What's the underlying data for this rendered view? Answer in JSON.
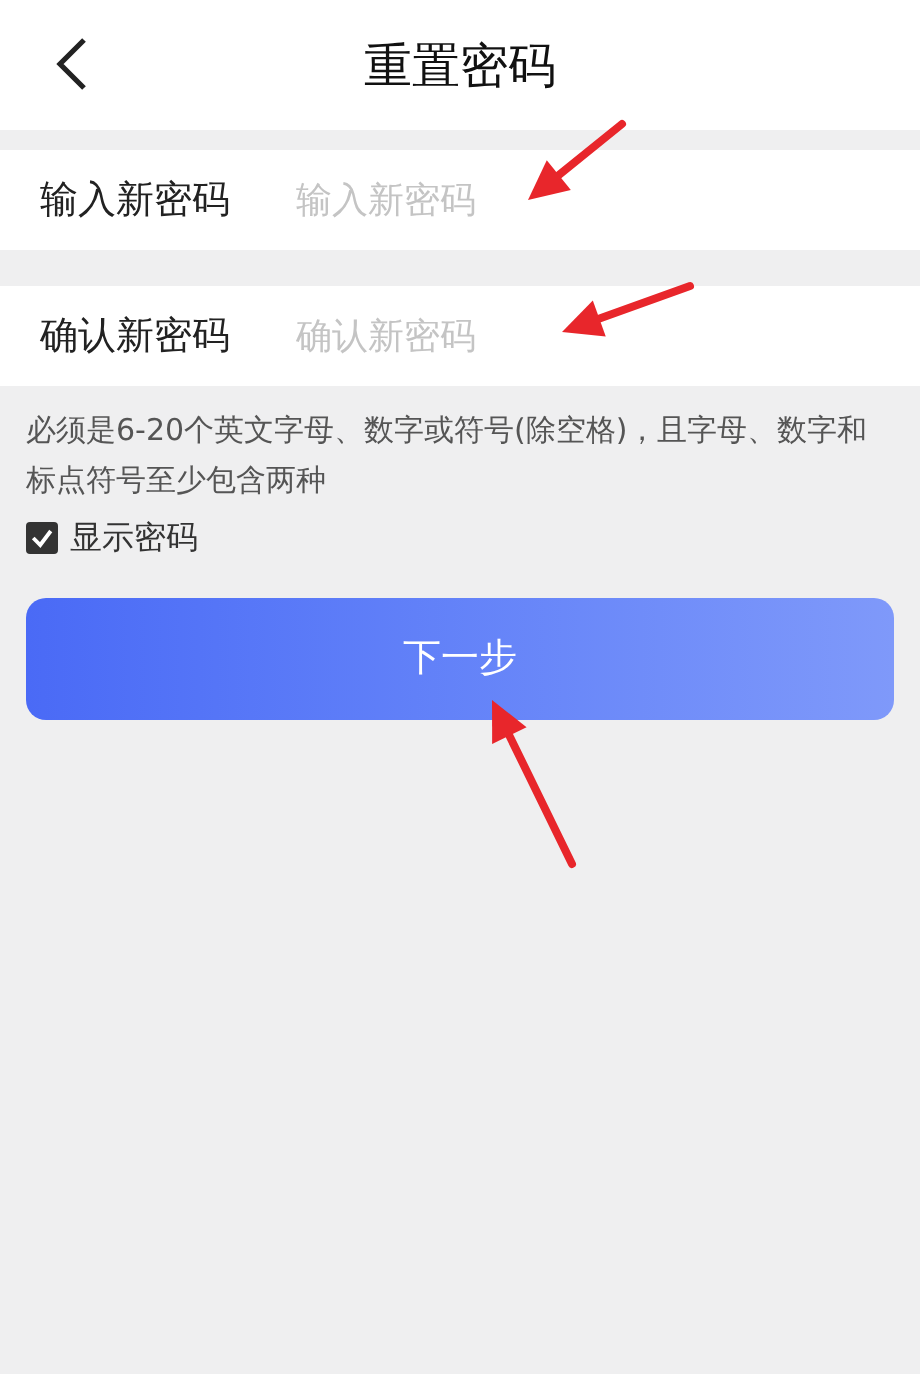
{
  "header": {
    "title": "重置密码"
  },
  "fields": [
    {
      "label": "输入新密码",
      "placeholder": "输入新密码"
    },
    {
      "label": "确认新密码",
      "placeholder": "确认新密码"
    }
  ],
  "hint": "必须是6-20个英文字母、数字或符号(除空格)，且字母、数字和标点符号至少包含两种",
  "show_password": {
    "label": "显示密码",
    "checked": true
  },
  "next_button": {
    "label": "下一步"
  }
}
